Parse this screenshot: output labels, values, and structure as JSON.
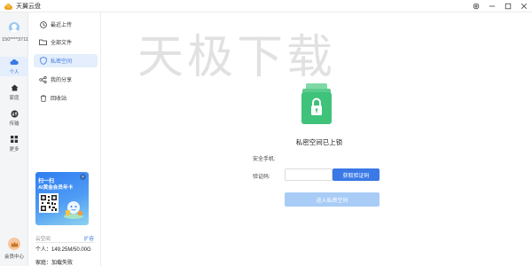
{
  "app": {
    "title": "天翼云盘"
  },
  "window_controls": [
    "settings-icon",
    "minimize-icon",
    "maximize-icon",
    "close-icon"
  ],
  "rail": {
    "user_id": "150****3711",
    "items": [
      {
        "label": "个人",
        "icon": "cloud-icon",
        "active": true
      },
      {
        "label": "家庭",
        "icon": "home-icon",
        "active": false
      },
      {
        "label": "传输",
        "icon": "transfer-icon",
        "active": false
      },
      {
        "label": "更多",
        "icon": "grid-icon",
        "active": false
      }
    ],
    "vip_label": "会员中心"
  },
  "sidebar": {
    "items": [
      {
        "label": "最近上传",
        "icon": "clock-icon"
      },
      {
        "label": "全部文件",
        "icon": "folder-icon"
      },
      {
        "label": "私密空间",
        "icon": "shield-icon",
        "active": true
      },
      {
        "label": "我的分享",
        "icon": "share-icon"
      },
      {
        "label": "回收站",
        "icon": "trash-icon"
      }
    ],
    "promo": {
      "line1": "扫一扫",
      "line2": "AI黄金会员年卡"
    },
    "storage": {
      "title": "云空间",
      "link": "扩容",
      "personal": "个人：149.25M/50.00G",
      "family": "家庭：加载失败"
    }
  },
  "main": {
    "watermark": "天极下载",
    "title": "私密空间已上锁",
    "phone_label": "安全手机:",
    "phone_value": "",
    "code_label": "验证码:",
    "code_value": "",
    "get_code_label": "获取验证码",
    "enter_label": "进入私密空间"
  },
  "colors": {
    "accent": "#3a79e6",
    "accent_disabled": "#a9ccf7",
    "folder_green": "#3fc27a"
  }
}
